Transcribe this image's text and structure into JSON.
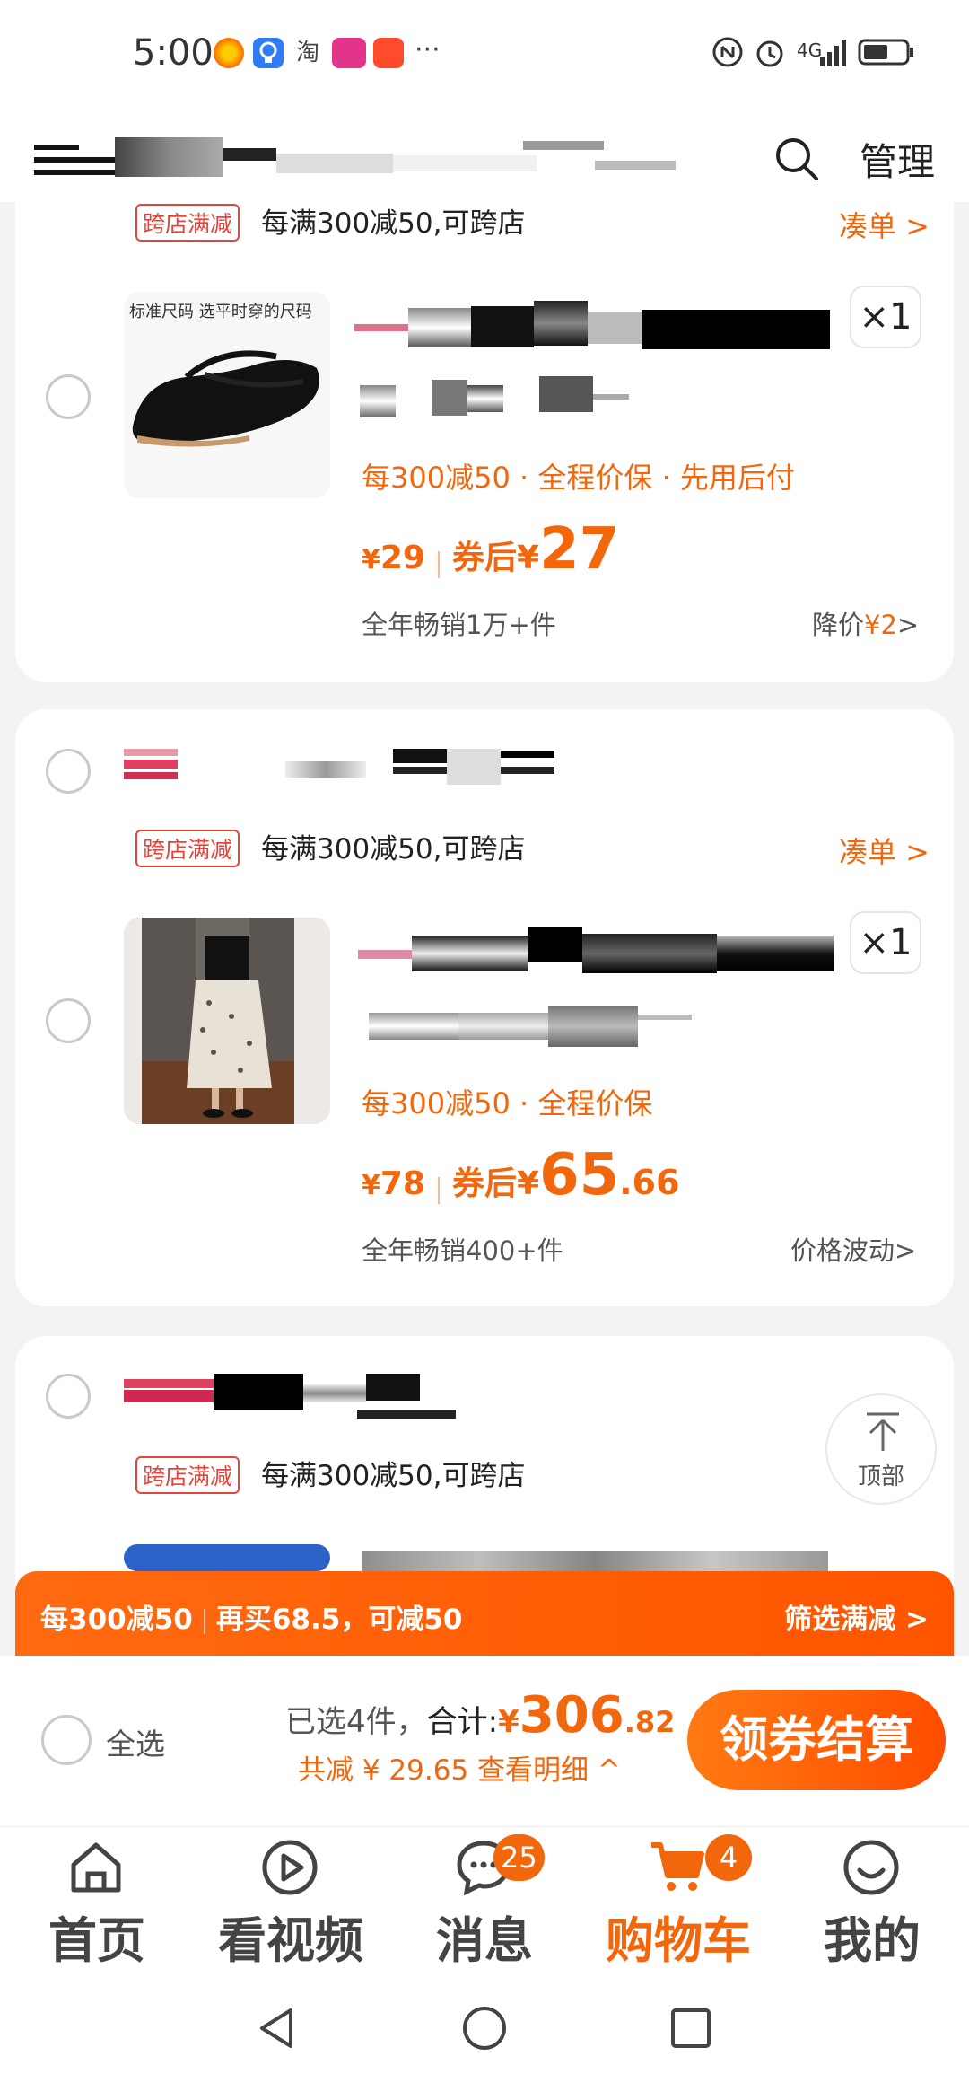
{
  "status_bar": {
    "time": "5:00",
    "more_label": "···",
    "network_label": "4G",
    "icons": [
      "sun-app-icon",
      "bulb-app-icon",
      "taobao-icon",
      "promo-app-icon",
      "taobao-sale-icon",
      "nfc-icon",
      "alarm-icon",
      "signal-icon",
      "battery-icon"
    ]
  },
  "header": {
    "manage_label": "管理",
    "search_icon": "search-icon"
  },
  "shops": [
    {
      "promo_tag": "跨店满减",
      "promo_text": "每满300减50,可跨店",
      "promo_link": "凑单 >",
      "item": {
        "thumb_caption": "标准尺码 选平时穿的尺码",
        "quantity": "×1",
        "benefits": "每300减50 · 全程价保 · 先用后付",
        "price_yen": "¥",
        "price_original": "29",
        "after_coupon_label": "券后",
        "price_after_int": "27",
        "price_after_dec": "",
        "sold": "全年畅销1万+件",
        "price_trend_prefix": "降价",
        "price_trend_value": "¥2",
        "price_trend_suffix": ">"
      }
    },
    {
      "promo_tag": "跨店满减",
      "promo_text": "每满300减50,可跨店",
      "promo_link": "凑单 >",
      "item": {
        "quantity": "×1",
        "benefits": "每300减50 · 全程价保",
        "price_yen": "¥",
        "price_original": "78",
        "after_coupon_label": "券后",
        "price_after_int": "65",
        "price_after_dec": ".66",
        "sold": "全年畅销400+件",
        "price_trend_prefix": "价格波动",
        "price_trend_value": "",
        "price_trend_suffix": ">"
      }
    },
    {
      "promo_tag": "跨店满减",
      "promo_text": "每满300减50,可跨店"
    }
  ],
  "back_to_top": {
    "label": "顶部"
  },
  "promo_banner": {
    "left_a": "每300减50",
    "left_b": "再买68.5，可减50",
    "right": "筛选满减 >"
  },
  "checkout": {
    "select_all": "全选",
    "selected_count": "已选4件，",
    "total_label": "合计:",
    "total_yen": "¥",
    "total_int": "306",
    "total_dec": ".82",
    "discount": "共减 ¥ 29.65  查看明细 ^",
    "button": "领券结算"
  },
  "bottom_nav": {
    "items": [
      {
        "label": "首页",
        "icon": "home-icon"
      },
      {
        "label": "看视频",
        "icon": "play-icon"
      },
      {
        "label": "消息",
        "icon": "message-icon",
        "badge": "25"
      },
      {
        "label": "购物车",
        "icon": "cart-icon",
        "badge": "4"
      },
      {
        "label": "我的",
        "icon": "profile-icon"
      }
    ]
  },
  "colors": {
    "accent": "#f2660c",
    "promo_red": "#e8433a",
    "background": "#f3f3f3"
  }
}
